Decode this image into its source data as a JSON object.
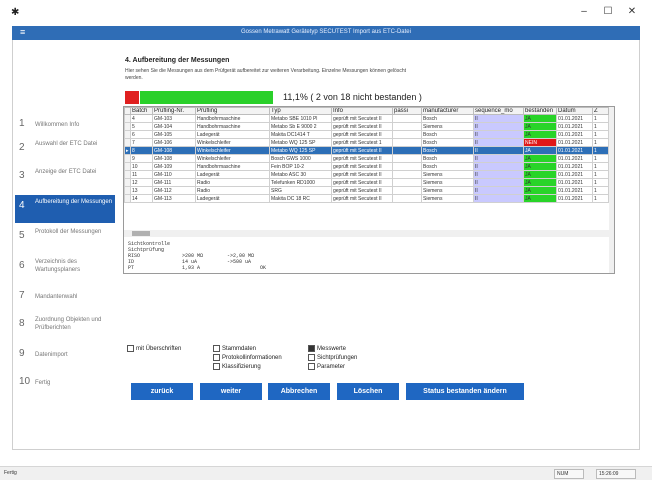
{
  "window": {
    "app_icon": "wind-icon",
    "controls": {
      "minimize": "–",
      "maximize": "☐",
      "close": "✕"
    }
  },
  "header": {
    "menu_icon": "≡",
    "title": "Gossen Metrawatt Gerätetyp SECUTEST Import aus ETC-Datei"
  },
  "sidebar": {
    "items": [
      {
        "num": "1",
        "label": "Willkommen Info"
      },
      {
        "num": "2",
        "label": "Auswahl der ETC Datei"
      },
      {
        "num": "3",
        "label": "Anzeige der ETC Datei"
      },
      {
        "num": "4",
        "label": "Aufbereitung der Messungen"
      },
      {
        "num": "5",
        "label": "Protokoll der Messungen"
      },
      {
        "num": "6",
        "label": "Verzeichnis des Wartungsplaners"
      },
      {
        "num": "7",
        "label": "Mandantenwahl"
      },
      {
        "num": "8",
        "label": "Zuordnung Objekten und Prüfberichten"
      },
      {
        "num": "9",
        "label": "Datenimport"
      },
      {
        "num": "10",
        "label": "Fertig"
      }
    ]
  },
  "main": {
    "title": "4. Aufbereitung der Messungen",
    "description": "Hier sehen Sie die Messungen aus dem Prüfgerät aufbereitet zur weiteren Verarbeitung. Einzelne Messungen können gelöscht werden.",
    "progress_text": "11,1%  ( 2 von 18 nicht bestanden )"
  },
  "table": {
    "columns": [
      "Batch",
      "Prüfling-Nr.",
      "Prüfling",
      "Typ",
      "Info",
      "passi",
      "manufacturer",
      "sequence_mo",
      "bestanden",
      "Datum",
      "Z"
    ],
    "rows": [
      [
        "4",
        "GM-103",
        "Handbohrmaschine",
        "Metabo SBE 1010 Pl",
        "geprüft mit Secutest II",
        "",
        "Bosch",
        "II",
        "JA",
        "01.01.2021",
        "1"
      ],
      [
        "5",
        "GM-104",
        "Handbohrmaschine",
        "Metabo Sb E 9000 2",
        "geprüft mit Secutest II",
        "",
        "Siemens",
        "II",
        "JA",
        "01.01.2021",
        "1"
      ],
      [
        "6",
        "GM-105",
        "Ladegerät",
        "Makita DC1414 T",
        "geprüft mit Secutest II",
        "",
        "Bosch",
        "II",
        "JA",
        "01.01.2021",
        "1"
      ],
      [
        "7",
        "GM-106",
        "Winkelschleifer",
        "Metabo WQ 125 SP",
        "geprüft mit Secutest 1",
        "",
        "Bosch",
        "II",
        "NEIN",
        "01.01.2021",
        "1"
      ],
      [
        "8",
        "GM-108",
        "Winkelschleifer",
        "Metabo WQ 125 SP",
        "geprüft mit Secutest II",
        "",
        "Bosch",
        "II",
        "JA",
        "01.01.2021",
        "1"
      ],
      [
        "9",
        "GM-108",
        "Winkelschleifer",
        "Bosch GWS 1000",
        "geprüft mit Secutest II",
        "",
        "Bosch",
        "II",
        "JA",
        "01.01.2021",
        "1"
      ],
      [
        "10",
        "GM-109",
        "Handbohrmaschine",
        "Fein BOP 10-2",
        "geprüft mit Secutest II",
        "",
        "Bosch",
        "II",
        "JA",
        "01.01.2021",
        "1"
      ],
      [
        "11",
        "GM-110",
        "Ladegerät",
        "Metabo ASC 30",
        "geprüft mit Secutest II",
        "",
        "Siemens",
        "II",
        "JA",
        "01.01.2021",
        "1"
      ],
      [
        "12",
        "GM-111",
        "Radio",
        "Telefunken RD1000",
        "geprüft mit Secutest II",
        "",
        "Siemens",
        "II",
        "JA",
        "01.01.2021",
        "1"
      ],
      [
        "13",
        "GM-112",
        "Radio",
        "SRG",
        "geprüft mit Secutest II",
        "",
        "Siemens",
        "II",
        "JA",
        "01.01.2021",
        "1"
      ],
      [
        "14",
        "GM-113",
        "Ladegerät",
        "Makita DC 18 RC",
        "geprüft mit Secutest II",
        "",
        "Siemens",
        "II",
        "JA",
        "01.01.2021",
        "1"
      ]
    ],
    "selected_row_index": 4,
    "status_colors": {
      "pass": "#28d428",
      "fail": "#e01818",
      "selected": "#2d6fb7"
    }
  },
  "detail": {
    "lines": [
      "Sichtkontrolle",
      "Sichtprüfung",
      "RISO              >200 MΩ        ->2,00 MΩ",
      "ID                14 uA          ->500 uA",
      "PT                1,93 A                    OK"
    ]
  },
  "checkboxes": [
    {
      "label": "mit Überschriften",
      "checked": false
    },
    {
      "label": "Stammdaten",
      "checked": false
    },
    {
      "label": "Protokollinformationen",
      "checked": false
    },
    {
      "label": "Klassifizierung",
      "checked": false
    },
    {
      "label": "Messwerte",
      "checked": true
    },
    {
      "label": "Sichtprüfungen",
      "checked": false
    },
    {
      "label": "Parameter",
      "checked": false
    }
  ],
  "buttons": {
    "back": "zurück",
    "next": "weiter",
    "cancel": "Abbrechen",
    "delete": "Löschen",
    "change_status": "Status bestanden ändern"
  },
  "statusbar": {
    "left": "Fertig",
    "mode": "NUM",
    "time": "15:26:09"
  }
}
